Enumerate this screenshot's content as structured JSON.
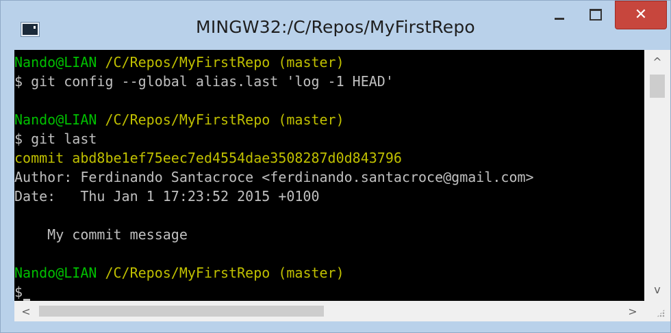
{
  "window": {
    "title": "MINGW32:/C/Repos/MyFirstRepo",
    "app_icon": "terminal-icon",
    "controls": {
      "minimize_icon": "minimize-icon",
      "maximize_icon": "maximize-icon",
      "close_icon": "close-icon",
      "close_glyph": "✕"
    }
  },
  "console": {
    "lines": [
      {
        "segments": [
          {
            "text": "Nando@LIAN ",
            "color": "green"
          },
          {
            "text": "/C/Repos/MyFirstRepo (master)",
            "color": "yellow"
          }
        ]
      },
      {
        "segments": [
          {
            "text": "$ git config --global alias.last 'log -1 HEAD'",
            "color": "white"
          }
        ]
      },
      {
        "segments": [
          {
            "text": "",
            "color": "white"
          }
        ]
      },
      {
        "segments": [
          {
            "text": "Nando@LIAN ",
            "color": "green"
          },
          {
            "text": "/C/Repos/MyFirstRepo (master)",
            "color": "yellow"
          }
        ]
      },
      {
        "segments": [
          {
            "text": "$ git last",
            "color": "white"
          }
        ]
      },
      {
        "segments": [
          {
            "text": "commit abd8be1ef75eec7ed4554dae3508287d0d843796",
            "color": "yellow"
          }
        ]
      },
      {
        "segments": [
          {
            "text": "Author: Ferdinando Santacroce <ferdinando.santacroce@gmail.com>",
            "color": "white"
          }
        ]
      },
      {
        "segments": [
          {
            "text": "Date:   Thu Jan 1 17:23:52 2015 +0100",
            "color": "white"
          }
        ]
      },
      {
        "segments": [
          {
            "text": "",
            "color": "white"
          }
        ]
      },
      {
        "segments": [
          {
            "text": "    My commit message",
            "color": "white"
          }
        ]
      },
      {
        "segments": [
          {
            "text": "",
            "color": "white"
          }
        ]
      },
      {
        "segments": [
          {
            "text": "Nando@LIAN ",
            "color": "green"
          },
          {
            "text": "/C/Repos/MyFirstRepo (master)",
            "color": "yellow"
          }
        ]
      },
      {
        "segments": [
          {
            "text": "$",
            "color": "white"
          }
        ],
        "cursor": true
      }
    ],
    "colors": {
      "green": "#00c000",
      "yellow": "#c0c000",
      "white": "#c0c0c0",
      "background": "#000000"
    }
  },
  "scrollbars": {
    "vertical": {
      "up_arrow": "^",
      "down_arrow": "v",
      "up_icon": "chevron-up-icon",
      "down_icon": "chevron-down-icon"
    },
    "horizontal": {
      "left_arrow": "<",
      "right_arrow": ">",
      "left_icon": "chevron-left-icon",
      "right_icon": "chevron-right-icon"
    }
  }
}
